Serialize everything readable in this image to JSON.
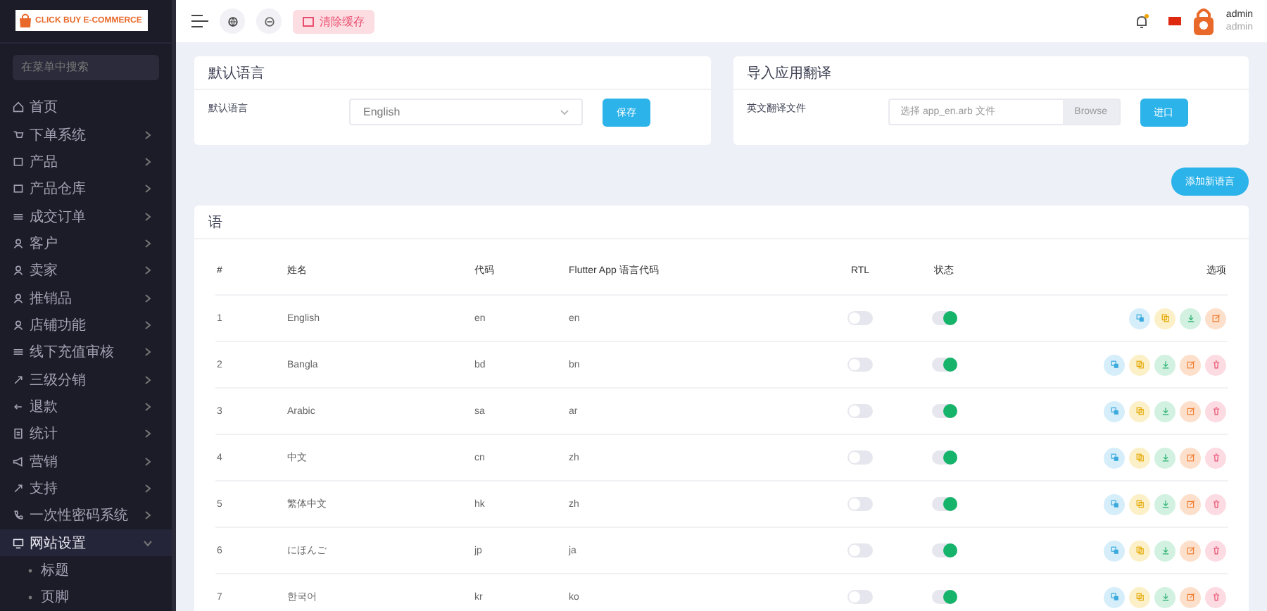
{
  "sidebar": {
    "logo_text": "CLICK BUY E-COMMERCE",
    "search_placeholder": "在菜单中搜索",
    "items": [
      {
        "label": "首页",
        "kind": "link",
        "selected": false
      },
      {
        "label": "下单系统",
        "kind": "group",
        "expanded": false,
        "selected": false
      },
      {
        "label": "产品",
        "kind": "group",
        "expanded": false,
        "selected": false
      },
      {
        "label": "产品仓库",
        "kind": "group",
        "expanded": false,
        "selected": false
      },
      {
        "label": "成交订单",
        "kind": "group",
        "expanded": false,
        "selected": false
      },
      {
        "label": "客户",
        "kind": "group",
        "expanded": false,
        "selected": false
      },
      {
        "label": "卖家",
        "kind": "group",
        "expanded": false,
        "selected": false
      },
      {
        "label": "推销品",
        "kind": "group",
        "expanded": false,
        "selected": false
      },
      {
        "label": "店铺功能",
        "kind": "group",
        "expanded": false,
        "selected": false
      },
      {
        "label": "线下充值审核",
        "kind": "group",
        "expanded": false,
        "selected": false
      },
      {
        "label": "三级分销",
        "kind": "group",
        "expanded": false,
        "selected": false
      },
      {
        "label": "退款",
        "kind": "group",
        "expanded": false,
        "selected": false
      },
      {
        "label": "统计",
        "kind": "group",
        "expanded": false,
        "selected": false
      },
      {
        "label": "营销",
        "kind": "group",
        "expanded": false,
        "selected": false
      },
      {
        "label": "支持",
        "kind": "group",
        "expanded": false,
        "selected": false
      },
      {
        "label": "一次性密码系统",
        "kind": "group",
        "expanded": false,
        "selected": false
      },
      {
        "label": "网站设置",
        "kind": "group",
        "expanded": true,
        "selected": true,
        "children": [
          {
            "label": "标题"
          },
          {
            "label": "页脚"
          }
        ]
      }
    ]
  },
  "topbar": {
    "clear_cache_button": "清除缓存",
    "user_name": "admin",
    "user_role": "admin"
  },
  "default_language_card": {
    "title": "默认语言",
    "label": "默认语言",
    "value": "English",
    "save_button": "保存"
  },
  "import_card": {
    "title": "导入应用翻译",
    "label": "英文翻译文件",
    "placeholder": "选择 app_en.arb 文件",
    "browse_button": "Browse",
    "import_button": "进口"
  },
  "add_language_button": "添加新语言",
  "table": {
    "title": "语",
    "columns": [
      "#",
      "姓名",
      "代码",
      "Flutter App 语言代码",
      "RTL",
      "状态",
      "选项"
    ],
    "rows": [
      {
        "number": "1",
        "name": "English",
        "code": "en",
        "app_code": "en",
        "rtl": false,
        "status": true,
        "actions": [
          {
            "kind": "translate"
          },
          {
            "kind": "copy"
          },
          {
            "kind": "download"
          },
          {
            "kind": "edit"
          }
        ]
      },
      {
        "number": "2",
        "name": "Bangla",
        "code": "bd",
        "app_code": "bn",
        "rtl": false,
        "status": true,
        "actions": [
          {
            "kind": "translate"
          },
          {
            "kind": "copy"
          },
          {
            "kind": "download"
          },
          {
            "kind": "edit"
          },
          {
            "kind": "delete"
          }
        ]
      },
      {
        "number": "3",
        "name": "Arabic",
        "code": "sa",
        "app_code": "ar",
        "rtl": false,
        "status": true,
        "actions": [
          {
            "kind": "translate"
          },
          {
            "kind": "copy"
          },
          {
            "kind": "download"
          },
          {
            "kind": "edit"
          },
          {
            "kind": "delete"
          }
        ]
      },
      {
        "number": "4",
        "name": "中文",
        "code": "cn",
        "app_code": "zh",
        "rtl": false,
        "status": true,
        "actions": [
          {
            "kind": "translate"
          },
          {
            "kind": "copy"
          },
          {
            "kind": "download"
          },
          {
            "kind": "edit"
          },
          {
            "kind": "delete"
          }
        ]
      },
      {
        "number": "5",
        "name": "繁体中文",
        "code": "hk",
        "app_code": "zh",
        "rtl": false,
        "status": true,
        "actions": [
          {
            "kind": "translate"
          },
          {
            "kind": "copy"
          },
          {
            "kind": "download"
          },
          {
            "kind": "edit"
          },
          {
            "kind": "delete"
          }
        ]
      },
      {
        "number": "6",
        "name": "にほんご",
        "code": "jp",
        "app_code": "ja",
        "rtl": false,
        "status": true,
        "actions": [
          {
            "kind": "translate"
          },
          {
            "kind": "copy"
          },
          {
            "kind": "download"
          },
          {
            "kind": "edit"
          },
          {
            "kind": "delete"
          }
        ]
      },
      {
        "number": "7",
        "name": "한국어",
        "code": "kr",
        "app_code": "ko",
        "rtl": false,
        "status": true,
        "actions": [
          {
            "kind": "translate"
          },
          {
            "kind": "copy"
          },
          {
            "kind": "download"
          },
          {
            "kind": "edit"
          },
          {
            "kind": "delete"
          }
        ]
      }
    ]
  }
}
